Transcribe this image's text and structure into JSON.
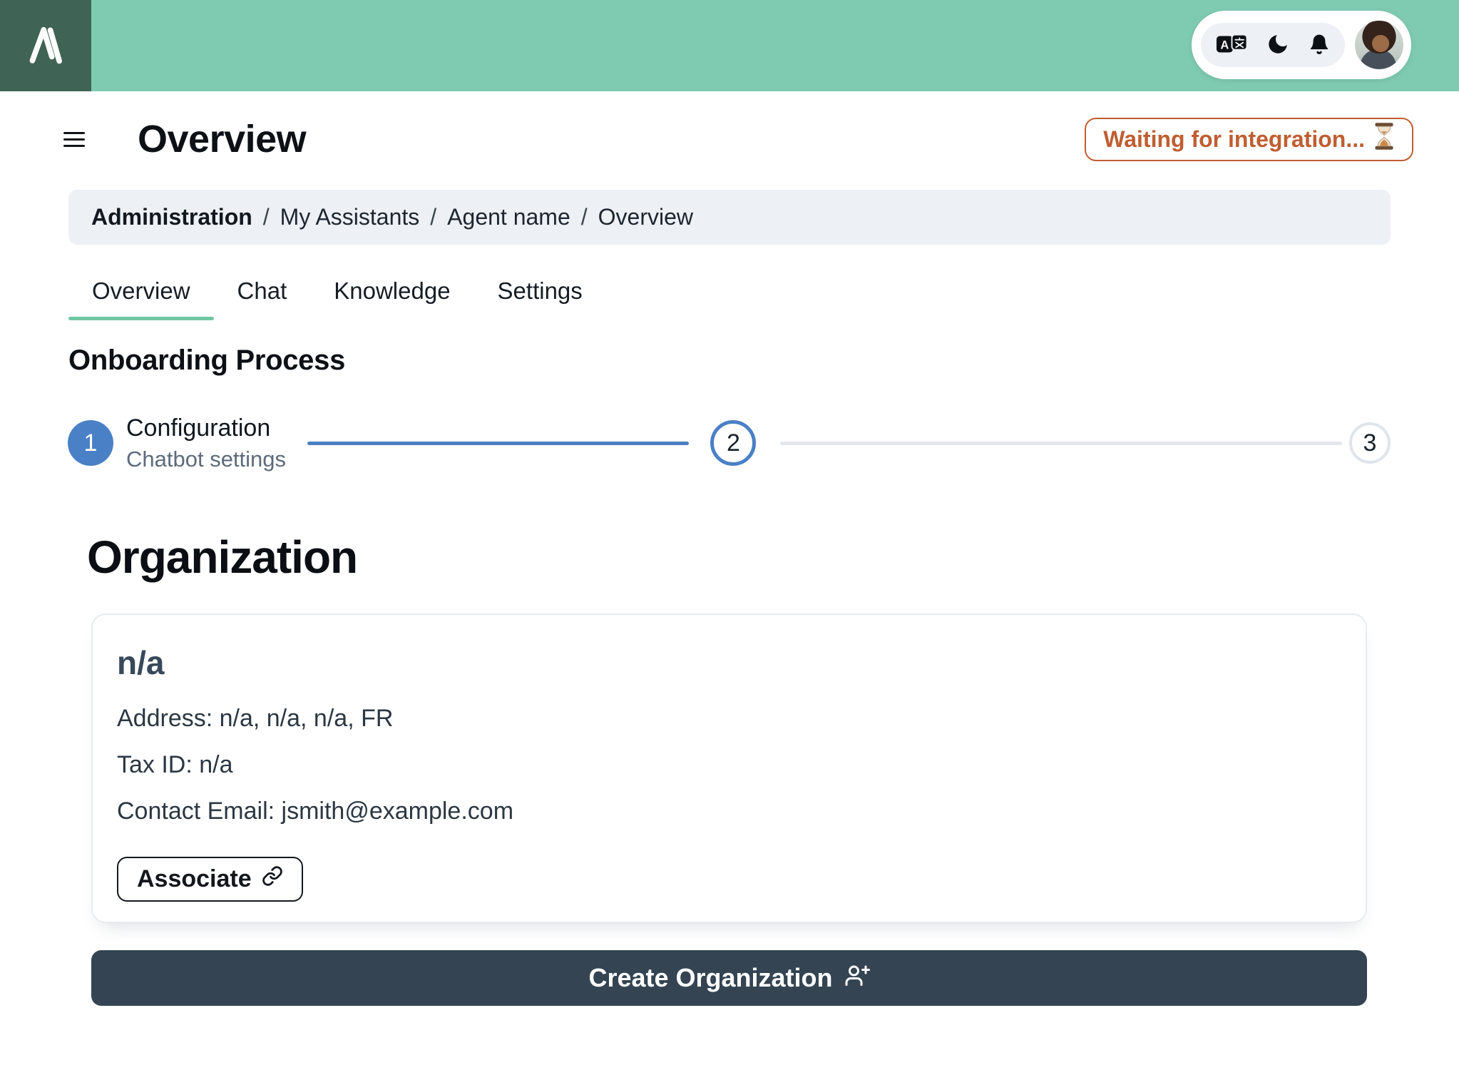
{
  "topbar": {
    "icons": {
      "brand": "brand-logo-icon",
      "translate": "translate-icon",
      "dark_mode": "moon-icon",
      "notifications": "bell-icon",
      "avatar": "user-avatar"
    }
  },
  "page": {
    "title": "Overview",
    "status_badge": {
      "label": "Waiting for integration...",
      "icon": "hourglass-icon"
    }
  },
  "breadcrumb": {
    "separator": "/",
    "items": [
      {
        "label": "Administration"
      },
      {
        "label": "My Assistants"
      },
      {
        "label": "Agent name"
      },
      {
        "label": "Overview"
      }
    ]
  },
  "tabs": [
    {
      "label": "Overview",
      "active": true
    },
    {
      "label": "Chat",
      "active": false
    },
    {
      "label": "Knowledge",
      "active": false
    },
    {
      "label": "Settings",
      "active": false
    }
  ],
  "onboarding": {
    "heading": "Onboarding Process",
    "steps": [
      {
        "number": "1",
        "title": "Configuration",
        "subtitle": "Chatbot settings",
        "state": "current"
      },
      {
        "number": "2",
        "state": "next"
      },
      {
        "number": "3",
        "state": "upcoming"
      }
    ]
  },
  "organization": {
    "heading": "Organization",
    "card": {
      "name": "n/a",
      "address": "Address: n/a, n/a, n/a, FR",
      "tax_id": "Tax ID: n/a",
      "contact_email": "Contact Email: jsmith@example.com",
      "associate_label": "Associate"
    },
    "create_label": "Create Organization"
  },
  "colors": {
    "header_green": "#7FCBB1",
    "logo_dark_green": "#3F6456",
    "accent_green": "#70C8A5",
    "badge_orange": "#BF5E31",
    "step_blue": "#4A80C6",
    "inactive_gray": "#E3E7EC",
    "dark_button": "#344452",
    "card_name_color": "#37495A",
    "breadcrumb_bg": "#EDF1F5"
  }
}
